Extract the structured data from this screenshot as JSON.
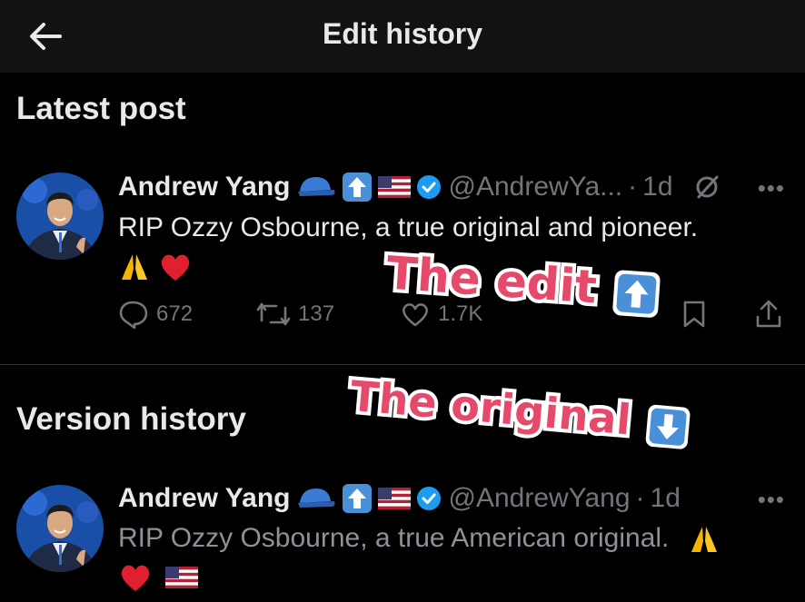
{
  "header": {
    "title": "Edit history",
    "back_icon": "back-arrow-icon"
  },
  "sections": {
    "latest": "Latest post",
    "history": "Version history"
  },
  "latest": {
    "name": "Andrew Yang",
    "handle": "@AndrewYa...",
    "separator": "·",
    "time": "1d",
    "text": "RIP Ozzy Osbourne, a true original and pioneer.",
    "stats": {
      "replies": "672",
      "reposts": "137",
      "likes": "1.7K"
    }
  },
  "original": {
    "name": "Andrew Yang",
    "handle": "@AndrewYang",
    "separator": "·",
    "time": "1d",
    "text": "RIP Ozzy Osbourne, a true American original."
  },
  "stickers": {
    "edit": "The edit",
    "original": "The original"
  },
  "colors": {
    "background": "#000000",
    "header": "#121212",
    "verified": "#1d9bf0",
    "muted": "#71767b",
    "sticker": "#e64a6b"
  }
}
